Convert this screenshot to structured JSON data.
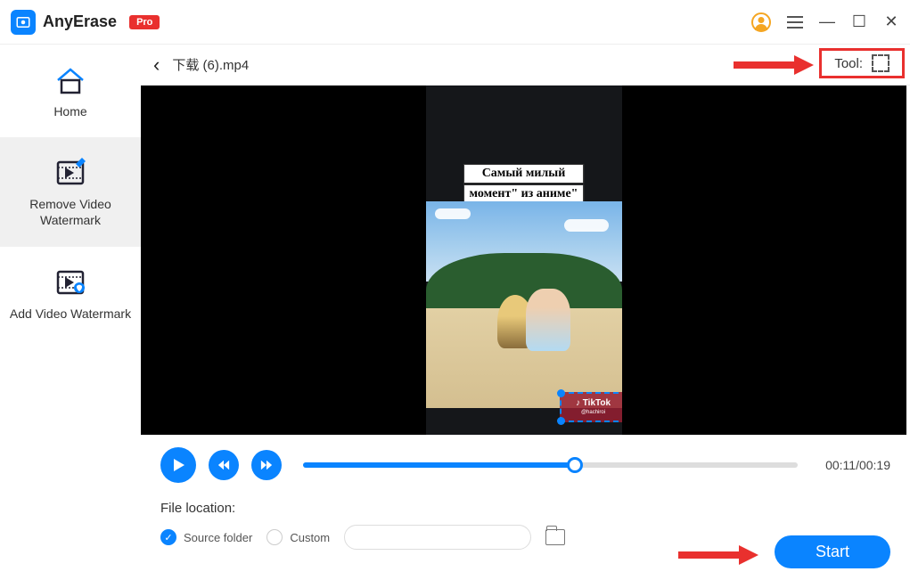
{
  "app": {
    "name": "AnyErase",
    "badge": "Pro"
  },
  "sidebar": {
    "items": [
      {
        "label": "Home"
      },
      {
        "label": "Remove Video Watermark"
      },
      {
        "label": "Add Video Watermark"
      }
    ]
  },
  "file": {
    "name": "下载 (6).mp4"
  },
  "tool": {
    "label": "Tool:"
  },
  "video": {
    "caption_line1": "Самый милый",
    "caption_line2": "момент\" из аниме\"",
    "watermark_text": "TikTok",
    "watermark_sub": "@hachiroi"
  },
  "playback": {
    "time_display": "00:11/00:19",
    "progress_percent": 55
  },
  "file_location": {
    "label": "File location:",
    "source_folder_label": "Source folder",
    "custom_label": "Custom",
    "selected": "source"
  },
  "actions": {
    "start": "Start"
  }
}
